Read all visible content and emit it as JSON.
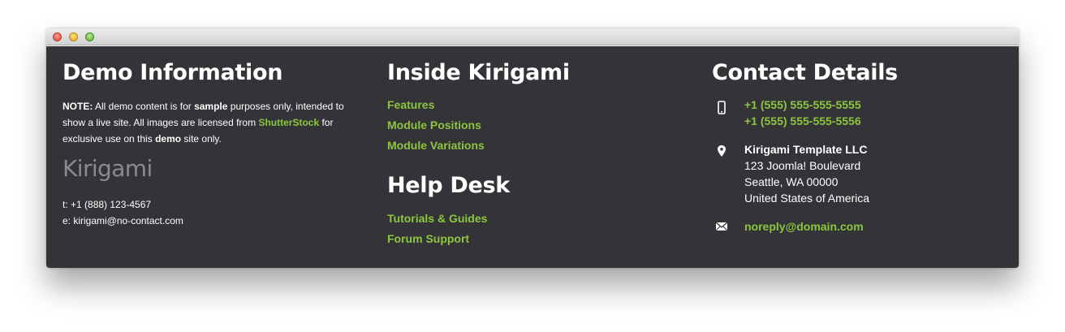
{
  "demo": {
    "title": "Demo Information",
    "note_label": "NOTE:",
    "note_1": " All demo content is for ",
    "note_sample": "sample",
    "note_2": " purposes only, intended to show a live site. All images are licensed from ",
    "note_link": "ShutterStock",
    "note_3": " for exclusive use on this ",
    "note_demo": "demo",
    "note_4": " site only.",
    "logo": "Kirigami",
    "phone": "t: +1 (888) 123-4567",
    "email": "e: kirigami@no-contact.com"
  },
  "inside": {
    "title": "Inside Kirigami",
    "links": [
      "Features",
      "Module Positions",
      "Module Variations"
    ]
  },
  "help": {
    "title": "Help Desk",
    "links": [
      "Tutorials & Guides",
      "Forum Support"
    ]
  },
  "contact": {
    "title": "Contact Details",
    "phone1": "+1 (555) 555-555-5555",
    "phone2": "+1 (555) 555-555-5556",
    "company": "Kirigami Template LLC",
    "address1": "123 Joomla! Boulevard",
    "address2": "Seattle, WA 00000",
    "address3": "United States of America",
    "email": "noreply@domain.com"
  },
  "colors": {
    "accent": "#8cc63f",
    "background": "#333338"
  },
  "icons": [
    "phone-icon",
    "location-pin-icon",
    "envelope-icon"
  ]
}
